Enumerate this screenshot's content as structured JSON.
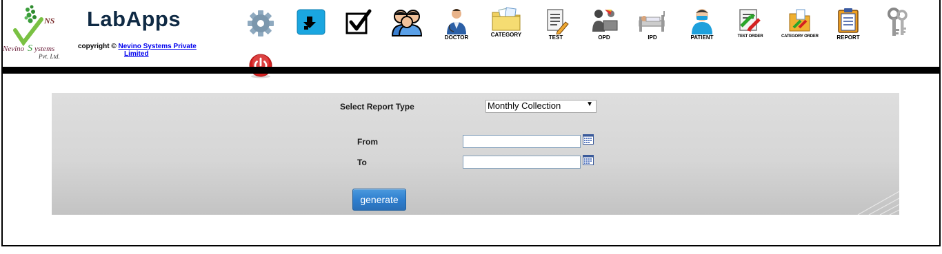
{
  "header": {
    "app_title": "LabApps",
    "copyright_prefix": "copyright ©",
    "company_link_line1": "Nevino Systems Private",
    "company_link_line2": "Limited",
    "logo": {
      "ns": "NS",
      "brand": "Nevino Systems",
      "suffix": "Pvt. Ltd."
    }
  },
  "nav": [
    {
      "name": "settings",
      "icon": "gear-icon",
      "label": ""
    },
    {
      "name": "download",
      "icon": "download-icon",
      "label": ""
    },
    {
      "name": "tasks",
      "icon": "checkbox-icon",
      "label": ""
    },
    {
      "name": "users",
      "icon": "users-icon",
      "label": ""
    },
    {
      "name": "doctor",
      "icon": "doctor-icon",
      "label": "DOCTOR"
    },
    {
      "name": "category",
      "icon": "category-folder-icon",
      "label": "CATEGORY"
    },
    {
      "name": "test",
      "icon": "test-icon",
      "label": "TEST"
    },
    {
      "name": "opd",
      "icon": "opd-icon",
      "label": "OPD"
    },
    {
      "name": "ipd",
      "icon": "ipd-icon",
      "label": "IPD"
    },
    {
      "name": "patient",
      "icon": "patient-icon",
      "label": "PATIENT"
    },
    {
      "name": "test-order",
      "icon": "test-order-icon",
      "label": "TEST ORDER"
    },
    {
      "name": "category-order",
      "icon": "category-order-icon",
      "label": "CATEGORY ORDER"
    },
    {
      "name": "report",
      "icon": "report-icon",
      "label": "REPORT"
    },
    {
      "name": "keys",
      "icon": "keys-icon",
      "label": ""
    }
  ],
  "power": {
    "icon": "power-icon"
  },
  "form": {
    "report_type_label": "Select Report Type",
    "report_type_selected": "Monthly Collection",
    "from_label": "From",
    "to_label": "To",
    "from_value": "",
    "to_value": "",
    "generate_label": "generate"
  },
  "colors": {
    "title": "#0f2a44",
    "generate_button": "#2f7fcf",
    "panel_background": "#d6d6d6",
    "power_button": "#d62020"
  }
}
